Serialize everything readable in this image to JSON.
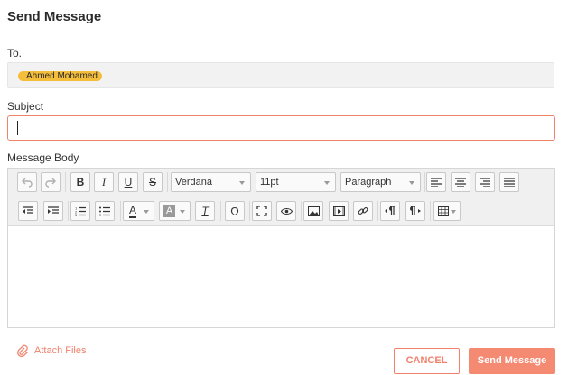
{
  "title": "Send Message",
  "to": {
    "label": "To.",
    "recipients": [
      "Ahmed Mohamed"
    ]
  },
  "subject": {
    "label": "Subject",
    "value": "",
    "placeholder": ""
  },
  "body": {
    "label": "Message Body",
    "toolbar": {
      "font_family": "Verdana",
      "font_size": "11pt",
      "block_format": "Paragraph",
      "bold": "B",
      "italic": "I",
      "underline": "U",
      "strike": "S",
      "text_color": "A",
      "bg_color": "A",
      "clear_format": "T",
      "special_char": "Ω"
    }
  },
  "actions": {
    "attach": "Attach Files",
    "cancel": "CANCEL",
    "send": "Send Message"
  },
  "colors": {
    "accent": "#f0826c",
    "chip": "#f5be3a"
  }
}
